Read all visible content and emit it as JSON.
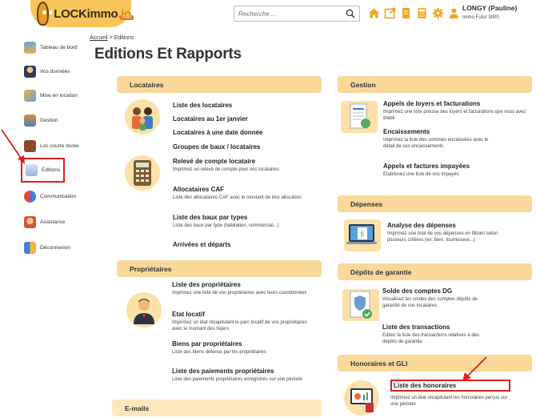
{
  "header": {
    "logo_text": "LOCKimmo",
    "logo_io": ".io",
    "logo_badge": "PRO",
    "search_placeholder": "Recherche ...",
    "user_name": "LONGY (Pauline)",
    "user_sub": "Immo Futur 3000"
  },
  "sidebar": {
    "items": [
      {
        "label": "Tableau de bord"
      },
      {
        "label": "Vos données"
      },
      {
        "label": "Mise en location"
      },
      {
        "label": "Gestion"
      },
      {
        "label": "Loc courte durée"
      },
      {
        "label": "Editions"
      },
      {
        "label": "Communication"
      },
      {
        "label": "Assistance"
      },
      {
        "label": "Déconnexion"
      }
    ]
  },
  "breadcrumb": {
    "home": "Accueil",
    "sep": ">",
    "current": "Editions"
  },
  "page_title": "Editions Et Rapports",
  "locataires": {
    "title": "Locataires",
    "links": [
      {
        "label": "Liste des locataires",
        "desc": ""
      },
      {
        "label": "Locataires au 1er janvier",
        "desc": ""
      },
      {
        "label": "Locataires à une date donnée",
        "desc": ""
      },
      {
        "label": "Groupes de baux / locataires",
        "desc": ""
      },
      {
        "label": "Relevé de compte locataire",
        "desc": "Imprimez un relevé de compte pour vos locataires"
      },
      {
        "label": "Allocataires CAF",
        "desc": "Liste des allocataires CAF avec le montant de leur allocation"
      },
      {
        "label": "Liste des baux par types",
        "desc": "Liste des baux par type (habitation, commercial...)"
      },
      {
        "label": "Arrivées et départs",
        "desc": ""
      }
    ]
  },
  "proprietaires": {
    "title": "Propriétaires",
    "links": [
      {
        "label": "Liste des propriétaires",
        "desc": "Imprimez une liste de vos propriétaires avec leurs coordonnées"
      },
      {
        "label": "Etat locatif",
        "desc": "Imprimez un état récapitulant le parc locatif de vos propriétaires avec le montant des loyers"
      },
      {
        "label": "Biens par propriétaires",
        "desc": "Liste des biens détenus par les propriétaires"
      },
      {
        "label": "Liste des paiements propriétaires",
        "desc": "Liste des paiements propriétaires enregistrés sur une période"
      }
    ]
  },
  "emails": {
    "title": "E-mails"
  },
  "gestion": {
    "title": "Gestion",
    "links": [
      {
        "label": "Appels de loyers et facturations",
        "desc": "Imprimez une liste précise des loyers et facturations que vous avez établi"
      },
      {
        "label": "Encaissements",
        "desc": "Imprimez la liste des sommes encaissées avec le détail de ces encaissements"
      },
      {
        "label": "Appels et factures impayées",
        "desc": "Etablissez une liste de vos impayés"
      }
    ]
  },
  "depenses": {
    "title": "Dépenses",
    "links": [
      {
        "label": "Analyse des dépenses",
        "desc": "Imprimez une liste de vos dépenses en filtrant selon plusieurs critères (ex: bien, fournisseur...)"
      }
    ]
  },
  "depots": {
    "title": "Dépôts de garantie",
    "links": [
      {
        "label": "Solde des comptes DG",
        "desc": "Visualisez les soldes des comptes dépôts de garantie de vos locataires"
      },
      {
        "label": "Liste des transactions",
        "desc": "Editez la liste des transactions relatives à des dépôts de garantie"
      }
    ]
  },
  "honoraires": {
    "title": "Honoraires et GLI",
    "links": [
      {
        "label": "Liste des honoraires",
        "desc": "Imprimez un état récapitulant les honoraires perçus sur une période"
      }
    ]
  },
  "colors": {
    "accent": "#fad89a",
    "highlight": "#d9211c",
    "brand": "#e87b17"
  }
}
